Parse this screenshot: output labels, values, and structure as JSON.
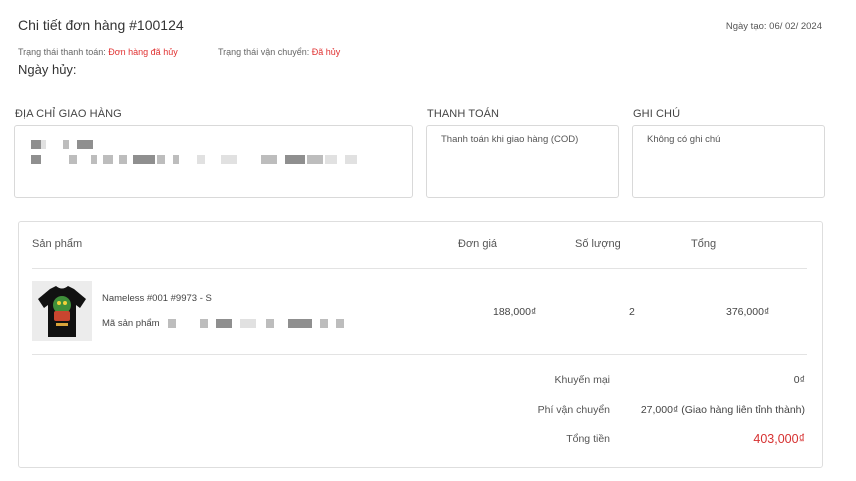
{
  "header": {
    "title": "Chi tiết đơn hàng #100124",
    "created_date": "Ngày tạo: 06/ 02/ 2024"
  },
  "status": {
    "payment_label": "Trạng thái thanh toán:",
    "payment_value": "Đơn hàng đã hủy",
    "shipping_label": "Trạng thái vận chuyển:",
    "shipping_value": "Đã hủy",
    "cancel_date_label": "Ngày hủy:"
  },
  "sections": {
    "shipping_address_label": "ĐỊA CHỈ GIAO HÀNG",
    "payment_label": "THANH TOÁN",
    "payment_method": "Thanh toán khi giao hàng (COD)",
    "note_label": "GHI CHÚ",
    "note_text": "Không có ghi chú"
  },
  "table": {
    "headers": {
      "product": "Sản phẩm",
      "unit_price": "Đơn giá",
      "quantity": "Số lượng",
      "total": "Tổng"
    },
    "items": [
      {
        "name": "Nameless #001 #9973 - S",
        "sku_label": "Mã sản phẩm",
        "unit_price": "188,000₫",
        "quantity": "2",
        "total": "376,000₫",
        "thumbnail_icon": "black-tshirt-graphic-icon"
      }
    ]
  },
  "summary": {
    "discount_label": "Khuyến mại",
    "discount_value": "0₫",
    "shipping_fee_label": "Phí vận chuyển",
    "shipping_fee_value": "27,000₫ (Giao hàng liên tỉnh thành)",
    "total_label": "Tổng tiền",
    "total_value": "403,000₫"
  },
  "colors": {
    "accent_red": "#e03131",
    "total_red": "#d63030",
    "border": "#d9d9d9"
  }
}
